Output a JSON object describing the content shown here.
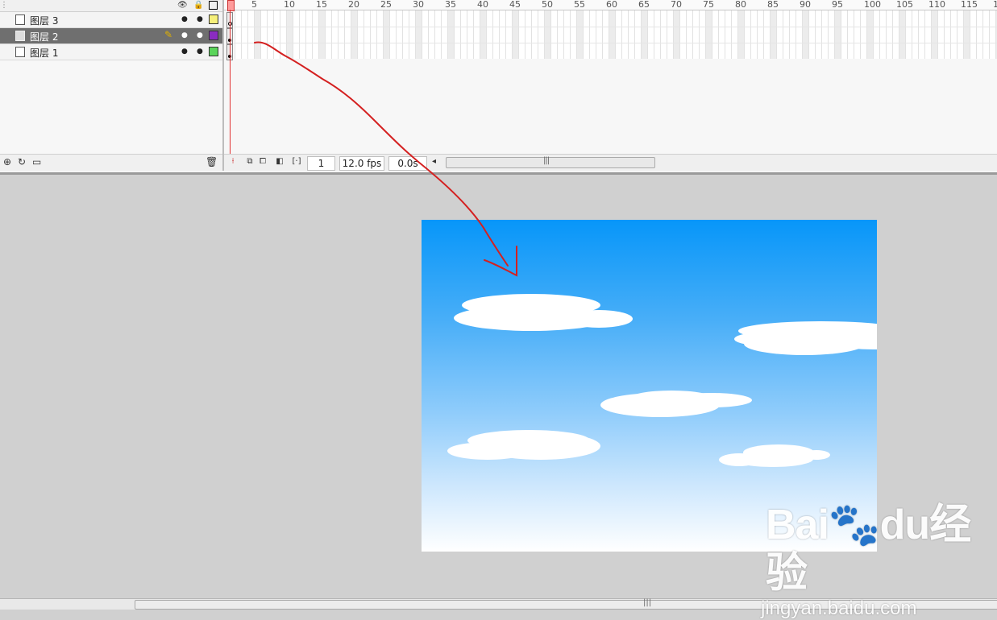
{
  "layers": [
    {
      "name": "图层 3",
      "color": "#f6f07a",
      "selected": false
    },
    {
      "name": "图层 2",
      "color": "#8a2cc0",
      "selected": true
    },
    {
      "name": "图层 1",
      "color": "#5ad45a",
      "selected": false
    }
  ],
  "ruler_ticks": [
    "5",
    "10",
    "15",
    "20",
    "25",
    "30",
    "35",
    "40",
    "45",
    "50",
    "55",
    "60",
    "65",
    "70",
    "75",
    "80",
    "85",
    "90",
    "95",
    "100",
    "105",
    "110",
    "115",
    "1"
  ],
  "timeline_footer": {
    "current_frame": "1",
    "frame_rate": "12.0 fps",
    "elapsed_time": "0.0s"
  },
  "colors": {
    "stage_top": "#0796f9",
    "stage_bottom": "#ffffff",
    "annotation": "#d42020",
    "selected_layer": "#6f6f6f"
  },
  "watermark": {
    "brand": "Bai🐾du经验",
    "url": "jingyan.baidu.com"
  }
}
